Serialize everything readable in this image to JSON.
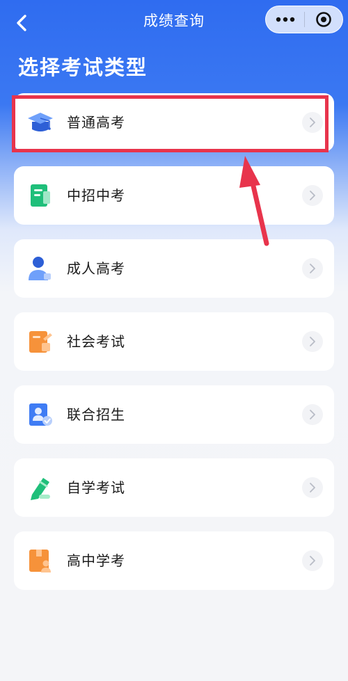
{
  "nav": {
    "title": "成绩查询"
  },
  "page_title": "选择考试类型",
  "exam_types": [
    {
      "label": "普通高考",
      "icon": "graduation-cap-icon",
      "color": "#3f7cf4"
    },
    {
      "label": "中招中考",
      "icon": "notebook-icon",
      "color": "#1fbf7a"
    },
    {
      "label": "成人高考",
      "icon": "person-icon",
      "color": "#3f7cf4"
    },
    {
      "label": "社会考试",
      "icon": "certificate-icon",
      "color": "#f6923a"
    },
    {
      "label": "联合招生",
      "icon": "id-badge-check-icon",
      "color": "#3f7cf4"
    },
    {
      "label": "自学考试",
      "icon": "pen-icon",
      "color": "#1fbf7a"
    },
    {
      "label": "高中学考",
      "icon": "box-person-icon",
      "color": "#f6923a"
    }
  ],
  "colors": {
    "header_blue": "#2f6cf0",
    "highlight_red": "#e8344c"
  }
}
